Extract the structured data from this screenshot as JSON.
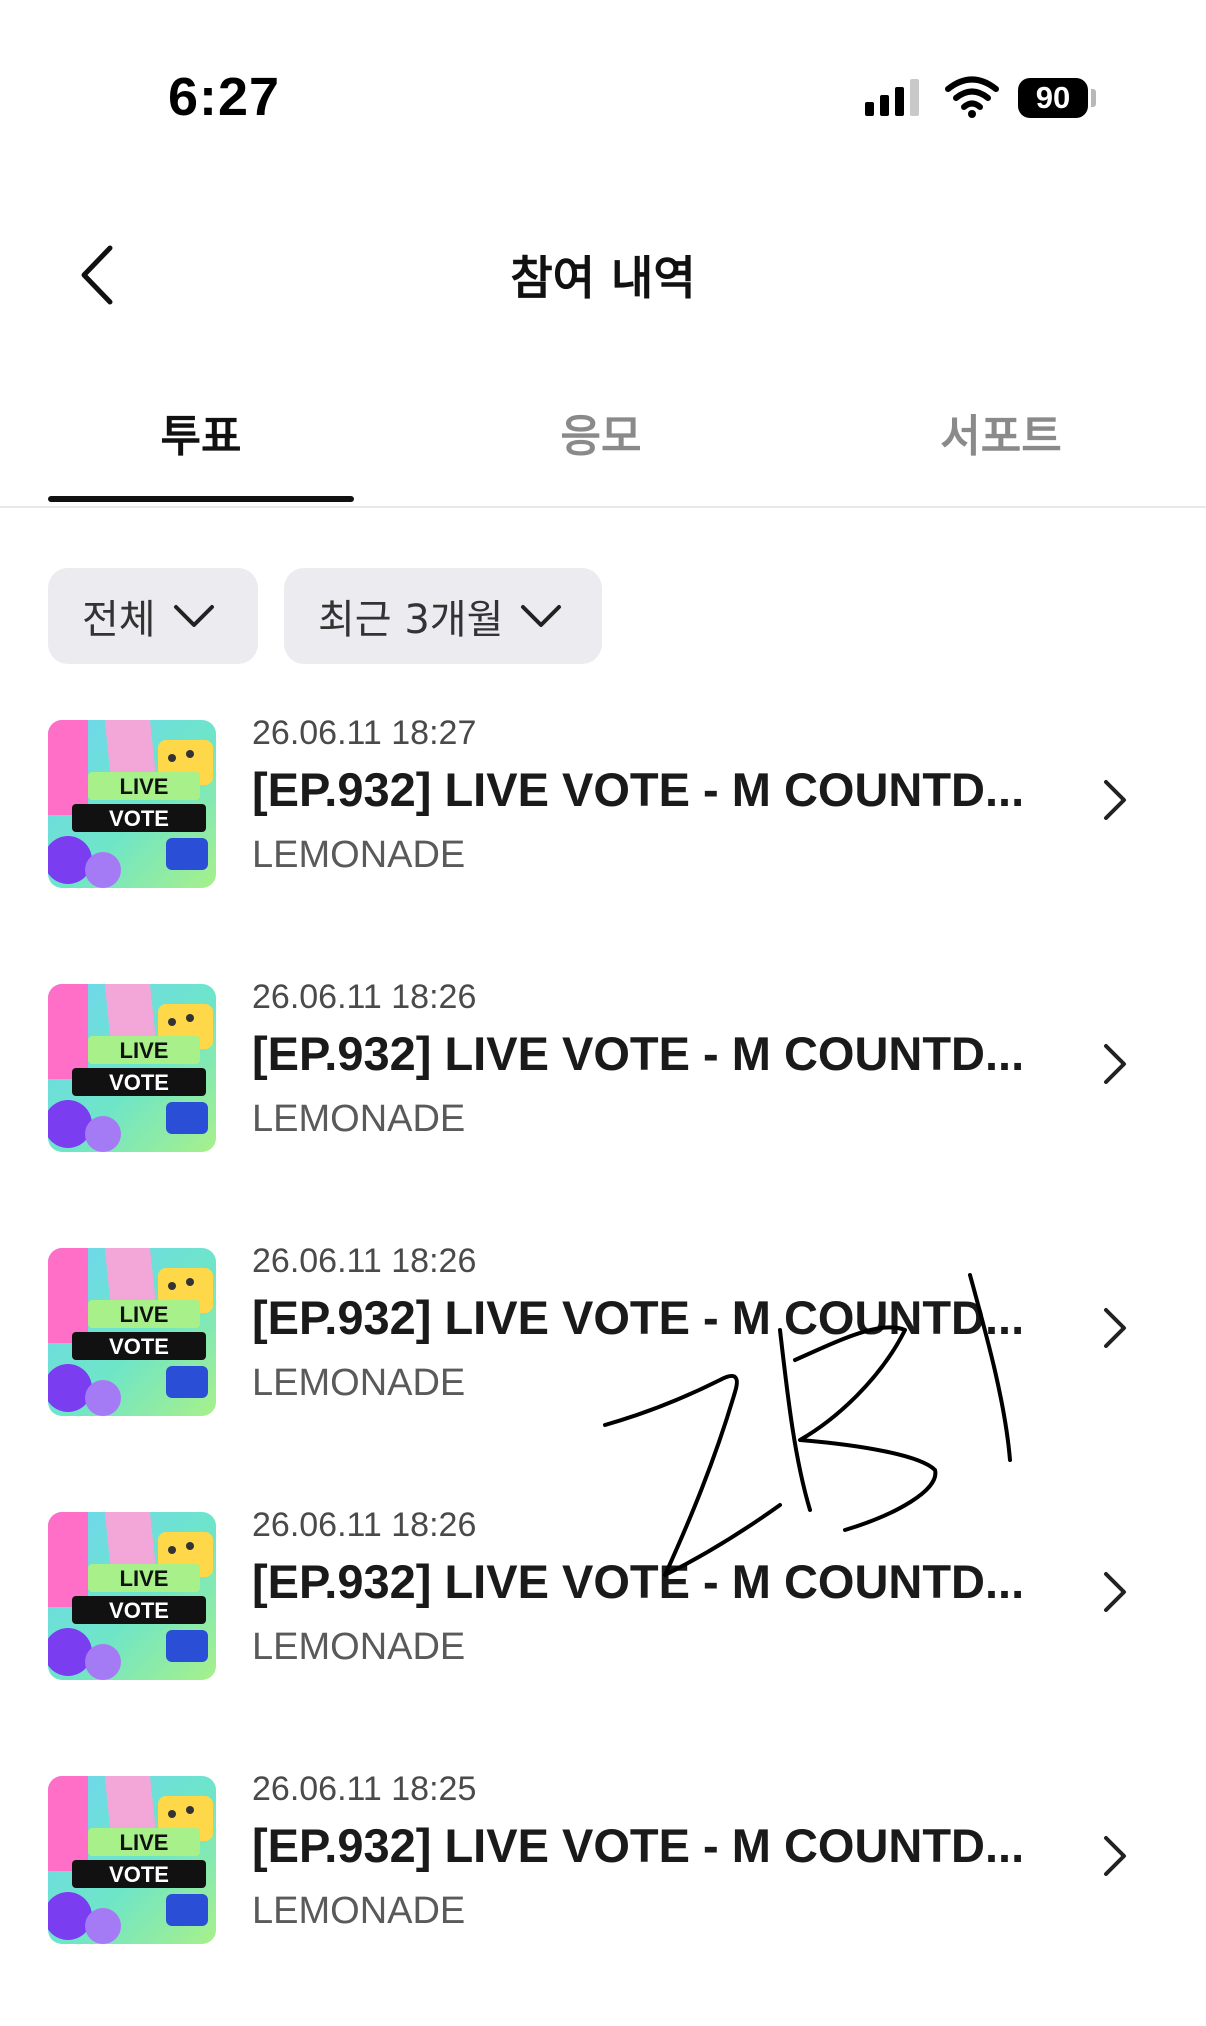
{
  "status_bar": {
    "time": "6:27",
    "battery": "90",
    "icons": [
      "signal-icon",
      "wifi-icon",
      "battery-icon"
    ]
  },
  "nav": {
    "title": "참여 내역",
    "back_icon": "chevron-left-icon"
  },
  "tabs": [
    {
      "label": "투표",
      "active": true
    },
    {
      "label": "응모",
      "active": false
    },
    {
      "label": "서포트",
      "active": false
    }
  ],
  "filters": {
    "category": "전체",
    "period": "최근 3개월"
  },
  "items": [
    {
      "date": "26.06.11 18:27",
      "title": "[EP.932] LIVE VOTE - M COUNTD...",
      "subtitle": "LEMONADE",
      "thumb_line1": "LIVE",
      "thumb_line2": "VOTE"
    },
    {
      "date": "26.06.11 18:26",
      "title": "[EP.932] LIVE VOTE - M COUNTD...",
      "subtitle": "LEMONADE",
      "thumb_line1": "LIVE",
      "thumb_line2": "VOTE"
    },
    {
      "date": "26.06.11 18:26",
      "title": "[EP.932] LIVE VOTE - M COUNTD...",
      "subtitle": "LEMONADE",
      "thumb_line1": "LIVE",
      "thumb_line2": "VOTE"
    },
    {
      "date": "26.06.11 18:26",
      "title": "[EP.932] LIVE VOTE - M COUNTD...",
      "subtitle": "LEMONADE",
      "thumb_line1": "LIVE",
      "thumb_line2": "VOTE"
    },
    {
      "date": "26.06.11 18:25",
      "title": "[EP.932] LIVE VOTE - M COUNTD...",
      "subtitle": "LEMONADE",
      "thumb_line1": "LIVE",
      "thumb_line2": "VOTE"
    }
  ],
  "annotation": {
    "handwritten_text": "ZB1"
  },
  "colors": {
    "text_primary": "#111111",
    "text_secondary": "#5a5a5a",
    "chip_bg": "#ececf0",
    "tab_indicator": "#111111"
  }
}
